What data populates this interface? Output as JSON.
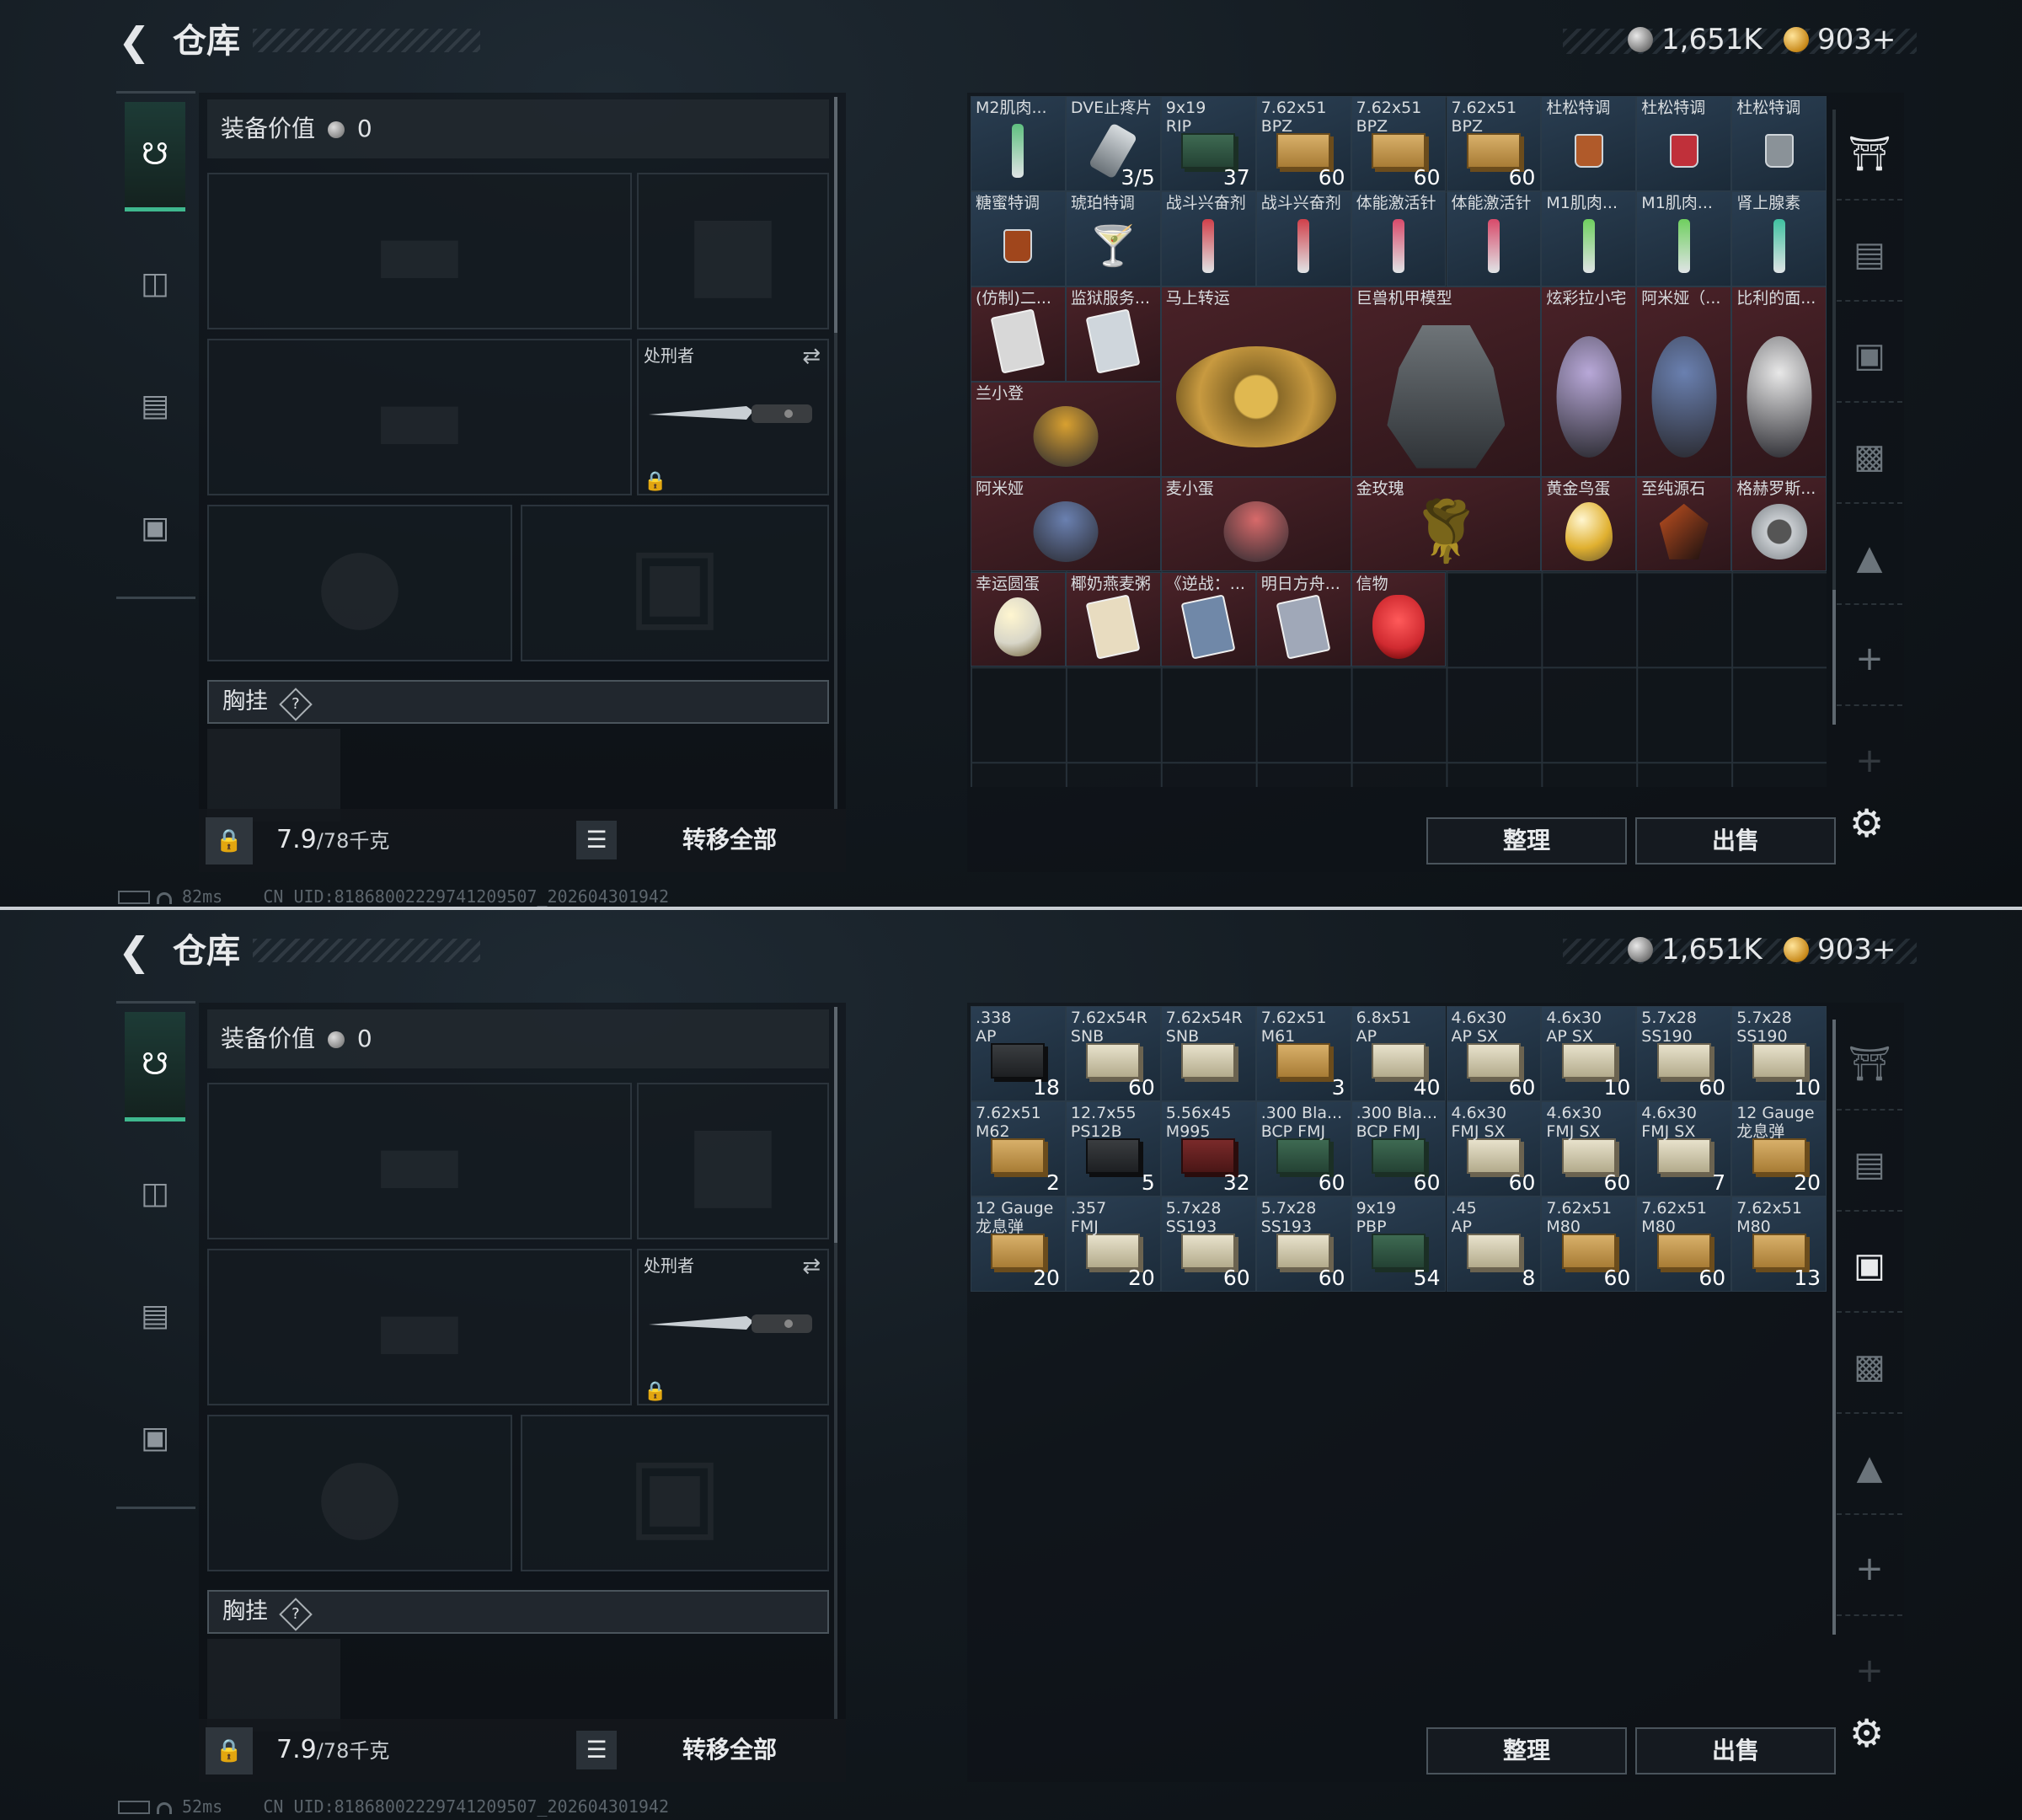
{
  "header": {
    "title": "仓库",
    "currency_silver": "1,651K",
    "currency_gold": "903+"
  },
  "equipment": {
    "value_label": "装备价值",
    "value": "0",
    "melee_label": "处刑者",
    "chest_label": "胸挂",
    "chest_hint": "?",
    "weight": "7.9",
    "weight_max": "/78千克",
    "transfer_all": "转移全部"
  },
  "stash": {
    "sort_label": "整理",
    "sell_label": "出售"
  },
  "status_top": {
    "ping": "82ms",
    "uid": "CN UID:8186800222974120​9507_202604301942"
  },
  "status_bottom": {
    "ping": "52ms",
    "uid": "CN UID:8186800222974120​9507_202604301942"
  },
  "top_items": [
    {
      "name": "M2肌肉...",
      "count": "",
      "kind": "syr",
      "color": "#5fbf7f"
    },
    {
      "name": "DVE止疼片",
      "count": "3/5",
      "kind": "pill",
      "color": "#9aa4ad"
    },
    {
      "name": "9x19\nRIP",
      "count": "37",
      "kind": "ammo",
      "color": "green"
    },
    {
      "name": "7.62x51\nBPZ",
      "count": "60",
      "kind": "ammo",
      "color": "gold"
    },
    {
      "name": "7.62x51\nBPZ",
      "count": "60",
      "kind": "ammo",
      "color": "gold"
    },
    {
      "name": "7.62x51\nBPZ",
      "count": "60",
      "kind": "ammo",
      "color": "gold"
    },
    {
      "name": "杜松特调",
      "count": "",
      "kind": "glass",
      "color": "#b05a2a"
    },
    {
      "name": "杜松特调",
      "count": "",
      "kind": "glass",
      "color": "#c0303a"
    },
    {
      "name": "杜松特调",
      "count": "",
      "kind": "glass",
      "color": "#8a9298"
    },
    {
      "name": "糖蜜特调",
      "count": "",
      "kind": "glass",
      "color": "#a0461c"
    },
    {
      "name": "琥珀特调",
      "count": "",
      "kind": "cocktail",
      "color": "#e89a2a"
    },
    {
      "name": "战斗兴奋剂",
      "count": "",
      "kind": "syr",
      "color": "#d0404a"
    },
    {
      "name": "战斗兴奋剂",
      "count": "",
      "kind": "syr",
      "color": "#d0404a"
    },
    {
      "name": "体能激活针",
      "count": "",
      "kind": "syr",
      "color": "#d84a6a"
    },
    {
      "name": "体能激活针",
      "count": "",
      "kind": "syr",
      "color": "#d84a6a"
    },
    {
      "name": "M1肌肉...",
      "count": "",
      "kind": "syr",
      "color": "#6fcf5f"
    },
    {
      "name": "M1肌肉...",
      "count": "",
      "kind": "syr",
      "color": "#6fcf5f"
    },
    {
      "name": "肾上腺素",
      "count": "",
      "kind": "syr",
      "color": "#3fc0a0"
    },
    {
      "name": "(仿制)二...",
      "count": "",
      "kind": "card",
      "color": "#d8d8d8"
    },
    {
      "name": "监狱服务...",
      "count": "",
      "kind": "card",
      "color": "#cfd6dc"
    },
    {
      "name": "马上转运",
      "count": "",
      "kind": "disc",
      "color": "#b08a3a"
    },
    {
      "name": "巨兽机甲模型",
      "count": "",
      "kind": "mech",
      "color": "#5a5e62"
    },
    {
      "name": "炫彩拉小宅",
      "count": "",
      "kind": "fig",
      "color": "#b8a8d8"
    },
    {
      "name": "阿米娅（...",
      "count": "",
      "kind": "fig",
      "color": "#6a80b0"
    },
    {
      "name": "比利的面...",
      "count": "",
      "kind": "fig",
      "color": "#e8e8e8"
    },
    {
      "name": "兰小登",
      "count": "",
      "kind": "fig",
      "color": "#d8a030"
    },
    {
      "name": "阿米娅",
      "count": "",
      "kind": "fig",
      "color": "#6a80b0"
    },
    {
      "name": "麦小蛋",
      "count": "",
      "kind": "fig",
      "color": "#d86a6a"
    },
    {
      "name": "金玫瑰",
      "count": "",
      "kind": "rose",
      "color": "#e0b040"
    },
    {
      "name": "黄金鸟蛋",
      "count": "",
      "kind": "egg",
      "color": "#e0b030"
    },
    {
      "name": "至纯源石",
      "count": "",
      "kind": "gem",
      "color": "#c05020"
    },
    {
      "name": "格赫罗斯...",
      "count": "",
      "kind": "badge",
      "color": "#c8ccd0"
    },
    {
      "name": "幸运圆蛋",
      "count": "",
      "kind": "egg",
      "color": "#d8d6c8"
    },
    {
      "name": "椰奶燕麦粥",
      "count": "",
      "kind": "card",
      "color": "#e8dcc0"
    },
    {
      "name": "《逆战：...",
      "count": "",
      "kind": "card",
      "color": "#7088a8"
    },
    {
      "name": "明日方舟...",
      "count": "",
      "kind": "card",
      "color": "#a0a8b8"
    },
    {
      "name": "信物",
      "count": "",
      "kind": "mask",
      "color": "#d02a30"
    }
  ],
  "bottom_items": [
    {
      "name": ".338\nAP",
      "count": "18",
      "color": "blk"
    },
    {
      "name": "7.62x54R\nSNB",
      "count": "60",
      "color": "white"
    },
    {
      "name": "7.62x54R\nSNB",
      "count": "",
      "color": "white"
    },
    {
      "name": "7.62x51\nM61",
      "count": "3",
      "color": "gold"
    },
    {
      "name": "6.8x51\nAP",
      "count": "40",
      "color": "white"
    },
    {
      "name": "4.6x30\nAP SX",
      "count": "60",
      "color": "white"
    },
    {
      "name": "4.6x30\nAP SX",
      "count": "10",
      "color": "white"
    },
    {
      "name": "5.7x28\nSS190",
      "count": "60",
      "color": "white"
    },
    {
      "name": "5.7x28\nSS190",
      "count": "10",
      "color": "white"
    },
    {
      "name": "7.62x51\nM62",
      "count": "2",
      "color": "gold"
    },
    {
      "name": "12.7x55\nPS12B",
      "count": "5",
      "color": "blk"
    },
    {
      "name": "5.56x45\nM995",
      "count": "32",
      "color": "red"
    },
    {
      "name": ".300 Bla...\nBCP FMJ",
      "count": "60",
      "color": "green"
    },
    {
      "name": ".300 Bla...\nBCP FMJ",
      "count": "60",
      "color": "green"
    },
    {
      "name": "4.6x30\nFMJ SX",
      "count": "60",
      "color": "white"
    },
    {
      "name": "4.6x30\nFMJ SX",
      "count": "60",
      "color": "white"
    },
    {
      "name": "4.6x30\nFMJ SX",
      "count": "7",
      "color": "white"
    },
    {
      "name": "12 Gauge\n龙息弹",
      "count": "20",
      "color": "gold"
    },
    {
      "name": "12 Gauge\n龙息弹",
      "count": "20",
      "color": "gold"
    },
    {
      "name": ".357\nFMJ",
      "count": "20",
      "color": "white"
    },
    {
      "name": "5.7x28\nSS193",
      "count": "60",
      "color": "white"
    },
    {
      "name": "5.7x28\nSS193",
      "count": "60",
      "color": "white"
    },
    {
      "name": "9x19\nPBP",
      "count": "54",
      "color": "green"
    },
    {
      "name": ".45\nAP",
      "count": "8",
      "color": "white"
    },
    {
      "name": "7.62x51\nM80",
      "count": "60",
      "color": "gold"
    },
    {
      "name": "7.62x51\nM80",
      "count": "60",
      "color": "gold"
    },
    {
      "name": "7.62x51\nM80",
      "count": "13",
      "color": "gold"
    }
  ]
}
